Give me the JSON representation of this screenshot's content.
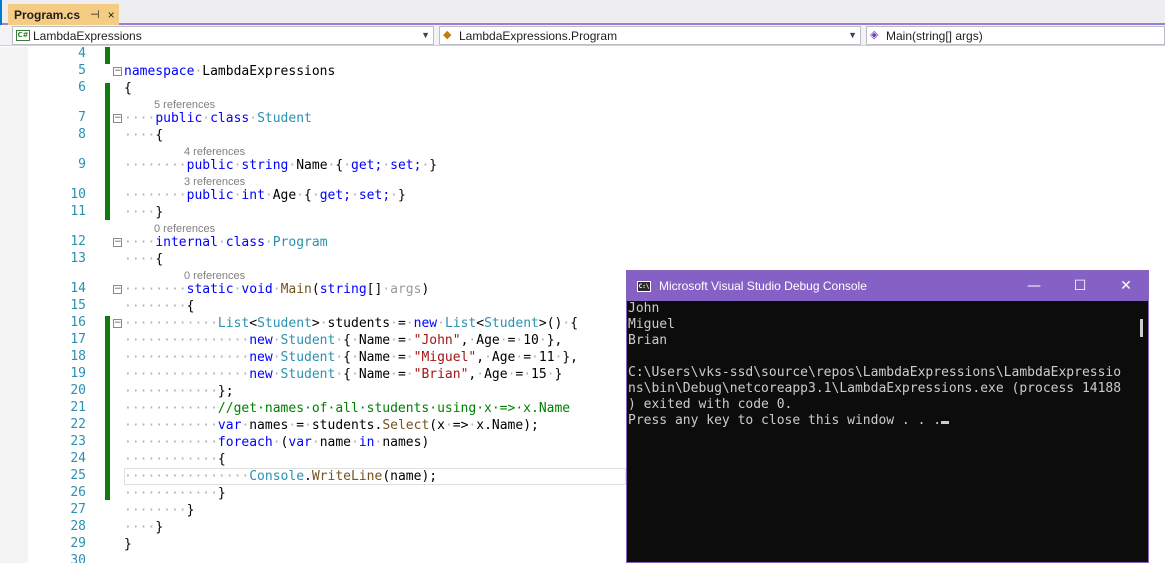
{
  "tab": {
    "label": "Program.cs",
    "pin": "⊣",
    "close": "×"
  },
  "nav": {
    "project": "LambdaExpressions",
    "class": "LambdaExpressions.Program",
    "member": "Main(string[] args)"
  },
  "codelens": {
    "student": "5 references",
    "name": "4 references",
    "age": "3 references",
    "program": "0 references",
    "main": "0 references"
  },
  "line_numbers": [
    "4",
    "5",
    "6",
    "7",
    "8",
    "9",
    "10",
    "11",
    "12",
    "13",
    "14",
    "15",
    "16",
    "17",
    "18",
    "19",
    "20",
    "21",
    "22",
    "23",
    "24",
    "25",
    "26",
    "27",
    "28",
    "29",
    "30"
  ],
  "code": {
    "ns_kw": "namespace",
    "ns_name": "LambdaExpressions",
    "public": "public",
    "class": "class",
    "student": "Student",
    "string": "string",
    "name": "Name",
    "get": "get;",
    "set": "set;",
    "int": "int",
    "age": "Age",
    "internal": "internal",
    "program": "Program",
    "static": "static",
    "void": "void",
    "main": "Main",
    "args": "args",
    "list": "List",
    "students": "students",
    "new": "new",
    "john": "\"John\"",
    "miguel": "\"Miguel\"",
    "brian": "\"Brian\"",
    "n10": "10",
    "n11": "11",
    "n15": "15",
    "comment": "//get·names·of·all·students·using·x·=>·x.Name",
    "var": "var",
    "names": "names",
    "select": "Select",
    "foreach": "foreach",
    "in": "in",
    "console": "Console",
    "writeline": "WriteLine"
  },
  "console": {
    "title": "Microsoft Visual Studio Debug Console",
    "icon": "C:\\",
    "minimize": "—",
    "maximize": "☐",
    "close": "✕",
    "lines": [
      "John",
      "Miguel",
      "Brian",
      "",
      "C:\\Users\\vks-ssd\\source\\repos\\LambdaExpressions\\LambdaExpressio",
      "ns\\bin\\Debug\\netcoreapp3.1\\LambdaExpressions.exe (process 14188",
      ") exited with code 0.",
      "Press any key to close this window . . ."
    ]
  },
  "colors": {
    "accent": "#8661c5",
    "keyword": "#0000ff",
    "type": "#2b91af",
    "string": "#a31515",
    "comment": "#008000",
    "changed": "#107c10"
  }
}
